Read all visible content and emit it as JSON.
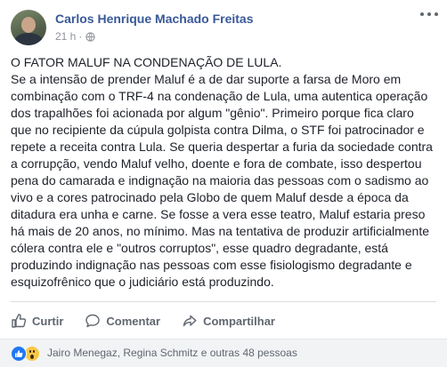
{
  "post": {
    "author": "Carlos Henrique Machado Freitas",
    "timestamp": "21 h",
    "separator": "·",
    "privacy_icon": "globe-icon",
    "paragraphs": [
      "O FATOR MALUF NA CONDENAÇÃO DE LULA.",
      "Se a intensão de prender Maluf é a de dar suporte a farsa de Moro em combinação com o TRF-4 na condenação de Lula, uma autentica operação dos trapalhões foi acionada por algum \"gênio\". Primeiro porque fica claro que no recipiente da cúpula golpista contra Dilma, o STF foi patrocinador e repete a receita contra Lula. Se queria despertar a furia da sociedade contra a corrupção, vendo Maluf velho, doente e fora de combate, isso despertou pena do camarada e indignação na maioria das pessoas com o sadismo ao vivo e a cores patrocinado pela Globo de quem Maluf desde a época da ditadura era unha e carne. Se fosse a vera esse teatro, Maluf estaria preso há mais de 20 anos, no mínimo. Mas na tentativa de produzir artificialmente cólera contra ele e \"outros corruptos\", esse quadro degradante, está produzindo indignação nas pessoas com esse fisiologismo degradante e esquizofrênico que o judiciário está produzindo."
    ]
  },
  "actions": {
    "like": "Curtir",
    "comment": "Comentar",
    "share": "Compartilhar"
  },
  "reactions": {
    "types": [
      "like",
      "wow"
    ],
    "summary": "Jairo Menegaz, Regina Schmitz e outras 48 pessoas"
  },
  "colors": {
    "author_link": "#385898",
    "text": "#1d2129",
    "muted": "#606770",
    "like_blue": "#2078f4",
    "wow_yellow": "#f7c844"
  }
}
